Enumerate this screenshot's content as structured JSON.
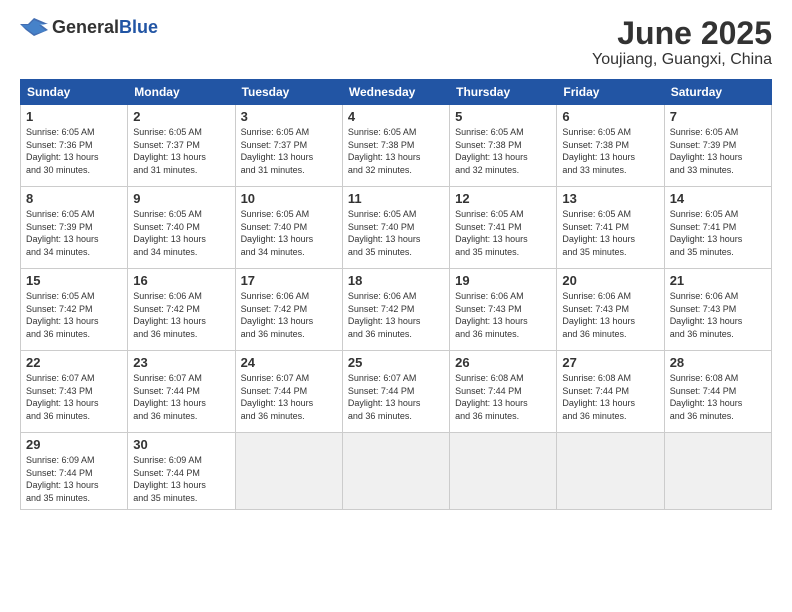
{
  "logo": {
    "general": "General",
    "blue": "Blue"
  },
  "header": {
    "month": "June 2025",
    "location": "Youjiang, Guangxi, China"
  },
  "columns": [
    "Sunday",
    "Monday",
    "Tuesday",
    "Wednesday",
    "Thursday",
    "Friday",
    "Saturday"
  ],
  "weeks": [
    [
      {
        "day": "1",
        "info": "Sunrise: 6:05 AM\nSunset: 7:36 PM\nDaylight: 13 hours\nand 30 minutes."
      },
      {
        "day": "2",
        "info": "Sunrise: 6:05 AM\nSunset: 7:37 PM\nDaylight: 13 hours\nand 31 minutes."
      },
      {
        "day": "3",
        "info": "Sunrise: 6:05 AM\nSunset: 7:37 PM\nDaylight: 13 hours\nand 31 minutes."
      },
      {
        "day": "4",
        "info": "Sunrise: 6:05 AM\nSunset: 7:38 PM\nDaylight: 13 hours\nand 32 minutes."
      },
      {
        "day": "5",
        "info": "Sunrise: 6:05 AM\nSunset: 7:38 PM\nDaylight: 13 hours\nand 32 minutes."
      },
      {
        "day": "6",
        "info": "Sunrise: 6:05 AM\nSunset: 7:38 PM\nDaylight: 13 hours\nand 33 minutes."
      },
      {
        "day": "7",
        "info": "Sunrise: 6:05 AM\nSunset: 7:39 PM\nDaylight: 13 hours\nand 33 minutes."
      }
    ],
    [
      {
        "day": "8",
        "info": "Sunrise: 6:05 AM\nSunset: 7:39 PM\nDaylight: 13 hours\nand 34 minutes."
      },
      {
        "day": "9",
        "info": "Sunrise: 6:05 AM\nSunset: 7:40 PM\nDaylight: 13 hours\nand 34 minutes."
      },
      {
        "day": "10",
        "info": "Sunrise: 6:05 AM\nSunset: 7:40 PM\nDaylight: 13 hours\nand 34 minutes."
      },
      {
        "day": "11",
        "info": "Sunrise: 6:05 AM\nSunset: 7:40 PM\nDaylight: 13 hours\nand 35 minutes."
      },
      {
        "day": "12",
        "info": "Sunrise: 6:05 AM\nSunset: 7:41 PM\nDaylight: 13 hours\nand 35 minutes."
      },
      {
        "day": "13",
        "info": "Sunrise: 6:05 AM\nSunset: 7:41 PM\nDaylight: 13 hours\nand 35 minutes."
      },
      {
        "day": "14",
        "info": "Sunrise: 6:05 AM\nSunset: 7:41 PM\nDaylight: 13 hours\nand 35 minutes."
      }
    ],
    [
      {
        "day": "15",
        "info": "Sunrise: 6:05 AM\nSunset: 7:42 PM\nDaylight: 13 hours\nand 36 minutes."
      },
      {
        "day": "16",
        "info": "Sunrise: 6:06 AM\nSunset: 7:42 PM\nDaylight: 13 hours\nand 36 minutes."
      },
      {
        "day": "17",
        "info": "Sunrise: 6:06 AM\nSunset: 7:42 PM\nDaylight: 13 hours\nand 36 minutes."
      },
      {
        "day": "18",
        "info": "Sunrise: 6:06 AM\nSunset: 7:42 PM\nDaylight: 13 hours\nand 36 minutes."
      },
      {
        "day": "19",
        "info": "Sunrise: 6:06 AM\nSunset: 7:43 PM\nDaylight: 13 hours\nand 36 minutes."
      },
      {
        "day": "20",
        "info": "Sunrise: 6:06 AM\nSunset: 7:43 PM\nDaylight: 13 hours\nand 36 minutes."
      },
      {
        "day": "21",
        "info": "Sunrise: 6:06 AM\nSunset: 7:43 PM\nDaylight: 13 hours\nand 36 minutes."
      }
    ],
    [
      {
        "day": "22",
        "info": "Sunrise: 6:07 AM\nSunset: 7:43 PM\nDaylight: 13 hours\nand 36 minutes."
      },
      {
        "day": "23",
        "info": "Sunrise: 6:07 AM\nSunset: 7:44 PM\nDaylight: 13 hours\nand 36 minutes."
      },
      {
        "day": "24",
        "info": "Sunrise: 6:07 AM\nSunset: 7:44 PM\nDaylight: 13 hours\nand 36 minutes."
      },
      {
        "day": "25",
        "info": "Sunrise: 6:07 AM\nSunset: 7:44 PM\nDaylight: 13 hours\nand 36 minutes."
      },
      {
        "day": "26",
        "info": "Sunrise: 6:08 AM\nSunset: 7:44 PM\nDaylight: 13 hours\nand 36 minutes."
      },
      {
        "day": "27",
        "info": "Sunrise: 6:08 AM\nSunset: 7:44 PM\nDaylight: 13 hours\nand 36 minutes."
      },
      {
        "day": "28",
        "info": "Sunrise: 6:08 AM\nSunset: 7:44 PM\nDaylight: 13 hours\nand 36 minutes."
      }
    ],
    [
      {
        "day": "29",
        "info": "Sunrise: 6:09 AM\nSunset: 7:44 PM\nDaylight: 13 hours\nand 35 minutes."
      },
      {
        "day": "30",
        "info": "Sunrise: 6:09 AM\nSunset: 7:44 PM\nDaylight: 13 hours\nand 35 minutes."
      },
      {
        "day": "",
        "info": "",
        "empty": true
      },
      {
        "day": "",
        "info": "",
        "empty": true
      },
      {
        "day": "",
        "info": "",
        "empty": true
      },
      {
        "day": "",
        "info": "",
        "empty": true
      },
      {
        "day": "",
        "info": "",
        "empty": true
      }
    ]
  ]
}
